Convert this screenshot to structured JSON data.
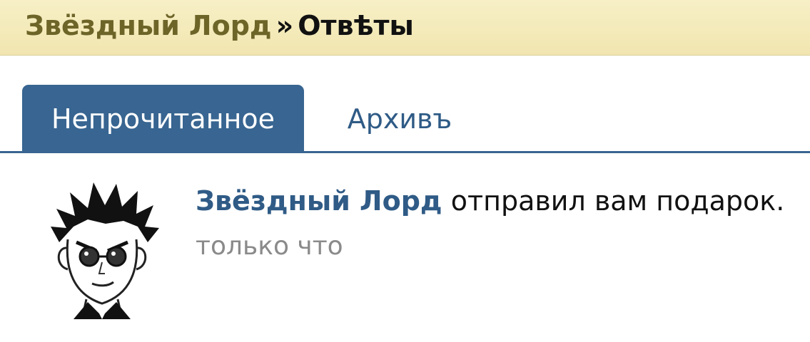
{
  "breadcrumb": {
    "parent": "Звёздный Лорд",
    "separator": "»",
    "current": "Отвѣты"
  },
  "tabs": [
    {
      "label": "Непрочитанное",
      "active": true
    },
    {
      "label": "Архивъ",
      "active": false
    }
  ],
  "notification": {
    "user": "Звёздный Лорд",
    "message": "отправил вам подарок.",
    "time": "только что"
  },
  "colors": {
    "header_bg": "#f3e9b7",
    "breadcrumb_link": "#6d6428",
    "accent": "#386591",
    "link": "#2f5b86",
    "time_text": "#8a8a8a"
  }
}
